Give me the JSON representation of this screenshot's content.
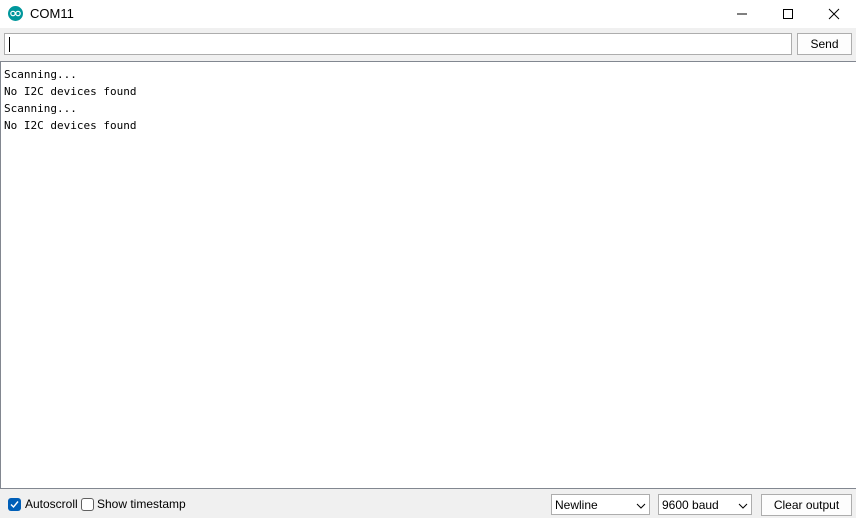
{
  "window": {
    "title": "COM11",
    "app_icon": "arduino-icon",
    "controls": [
      "minimize-icon",
      "maximize-icon",
      "close-icon"
    ]
  },
  "input_bar": {
    "value": "",
    "send_label": "Send"
  },
  "output": {
    "lines": [
      "Scanning...",
      "No I2C devices found",
      "Scanning...",
      "No I2C devices found"
    ]
  },
  "status_bar": {
    "autoscroll": {
      "label": "Autoscroll",
      "checked": true
    },
    "show_timestamp": {
      "label": "Show timestamp",
      "checked": false
    },
    "line_ending": {
      "selected": "Newline"
    },
    "baud_rate": {
      "selected": "9600 baud"
    },
    "clear_label": "Clear output"
  },
  "colors": {
    "accent": "#005fb8",
    "arduino_teal": "#00979c"
  }
}
